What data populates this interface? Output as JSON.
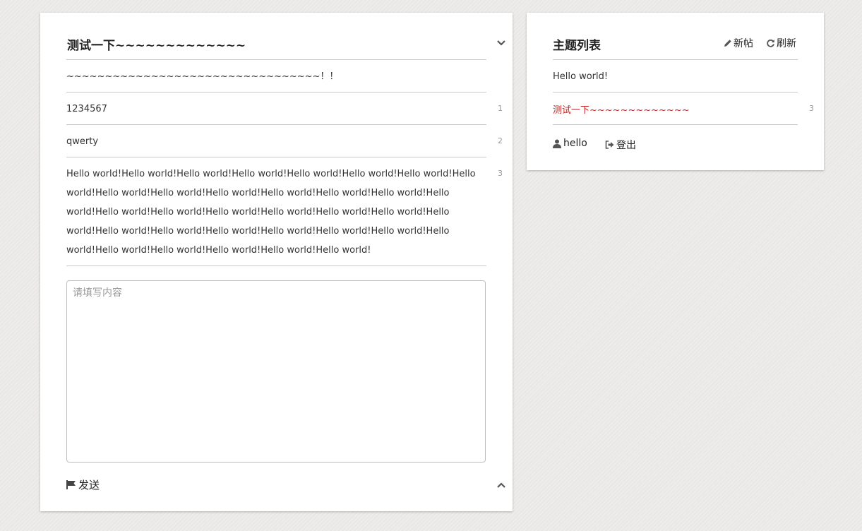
{
  "thread": {
    "title": "测试一下~~~~~~~~~~~~~",
    "posts": [
      {
        "text": "~~~~~~~~~~~~~~~~~~~~~~~~~~~~~~~~~！！",
        "num": ""
      },
      {
        "text": "1234567",
        "num": "1"
      },
      {
        "text": "qwerty",
        "num": "2"
      },
      {
        "text": "Hello world!Hello world!Hello world!Hello world!Hello world!Hello world!Hello world!Hello world!Hello world!Hello world!Hello world!Hello world!Hello world!Hello world!Hello world!Hello world!Hello world!Hello world!Hello world!Hello world!Hello world!Hello world!Hello world!Hello world!Hello world!Hello world!Hello world!Hello world!Hello world!Hello world!Hello world!Hello world!Hello world!Hello world!",
        "num": "3"
      }
    ],
    "reply": {
      "placeholder": "请填写内容",
      "value": ""
    },
    "send_label": "发送"
  },
  "topics": {
    "title": "主题列表",
    "new_label": "新帖",
    "refresh_label": "刷新",
    "items": [
      {
        "title": "Hello world!",
        "count": ""
      },
      {
        "title": "测试一下~~~~~~~~~~~~~",
        "count": "3"
      }
    ],
    "user": "hello",
    "logout_label": "登出"
  },
  "colors": {
    "active_topic": "#c81e1e",
    "background": "#e9e8e6"
  },
  "icons": [
    "chevron-down-icon",
    "chevron-up-icon",
    "flag-icon",
    "pencil-icon",
    "refresh-icon",
    "user-icon",
    "logout-icon"
  ]
}
